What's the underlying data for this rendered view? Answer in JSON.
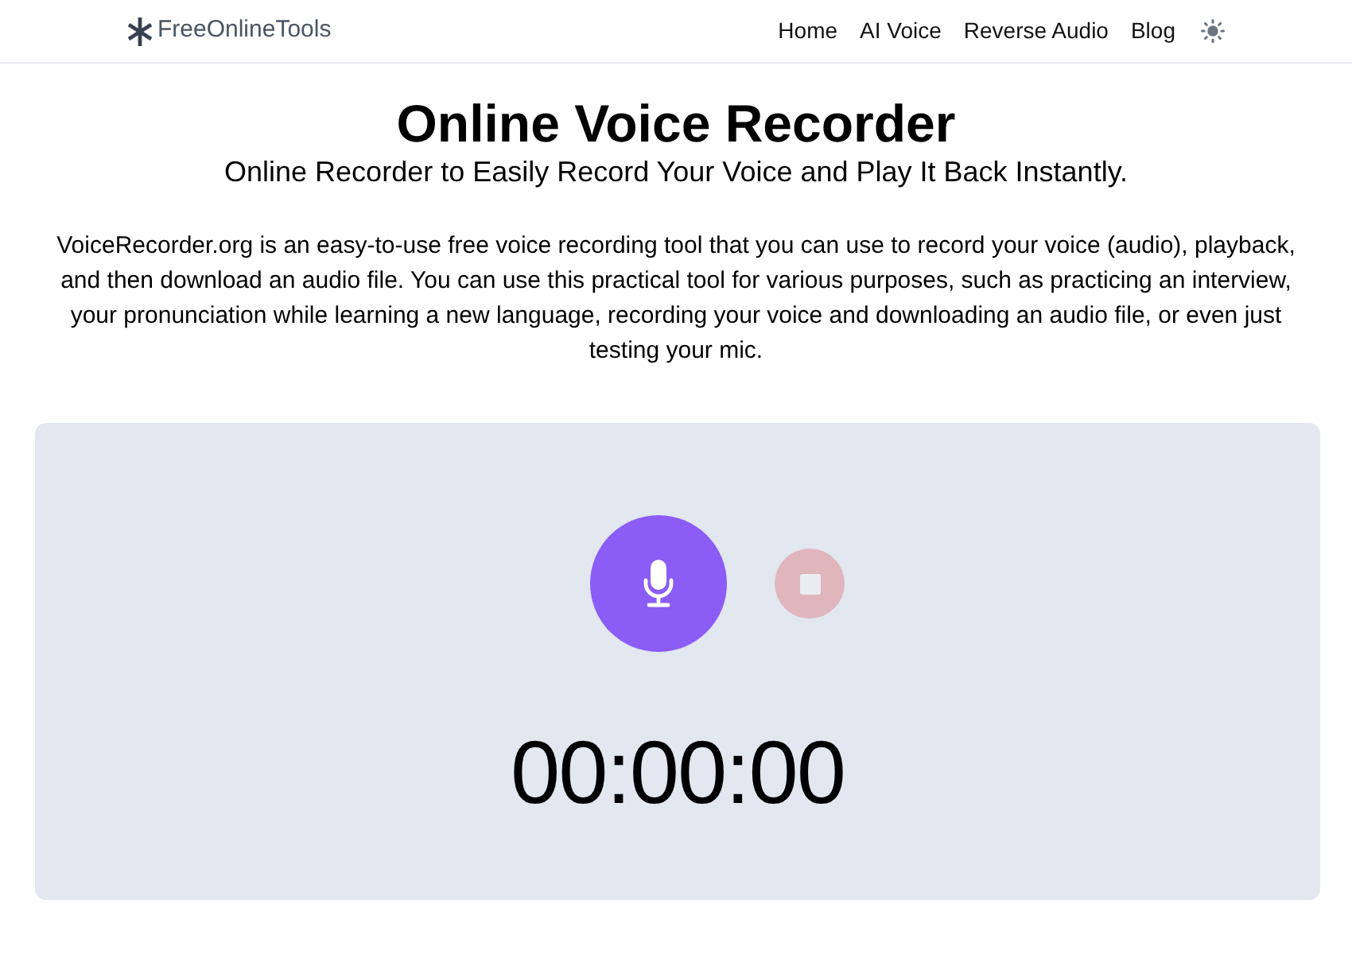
{
  "navbar": {
    "brand": "FreeOnlineTools",
    "links": [
      {
        "label": "Home"
      },
      {
        "label": "AI Voice"
      },
      {
        "label": "Reverse Audio"
      },
      {
        "label": "Blog"
      }
    ]
  },
  "header": {
    "title": "Online Voice Recorder",
    "subtitle": "Online Recorder to Easily Record Your Voice and Play It Back Instantly.",
    "description": "VoiceRecorder.org is an easy-to-use free voice recording tool that you can use to record your voice (audio), playback, and then download an audio file. You can use this practical tool for various purposes, such as practicing an interview, your pronunciation while learning a new language, recording your voice and downloading an audio file, or even just testing your mic."
  },
  "recorder": {
    "record_button": {
      "disabled": false
    },
    "stop_button": {
      "disabled": true
    },
    "timer": "00:00:00"
  }
}
